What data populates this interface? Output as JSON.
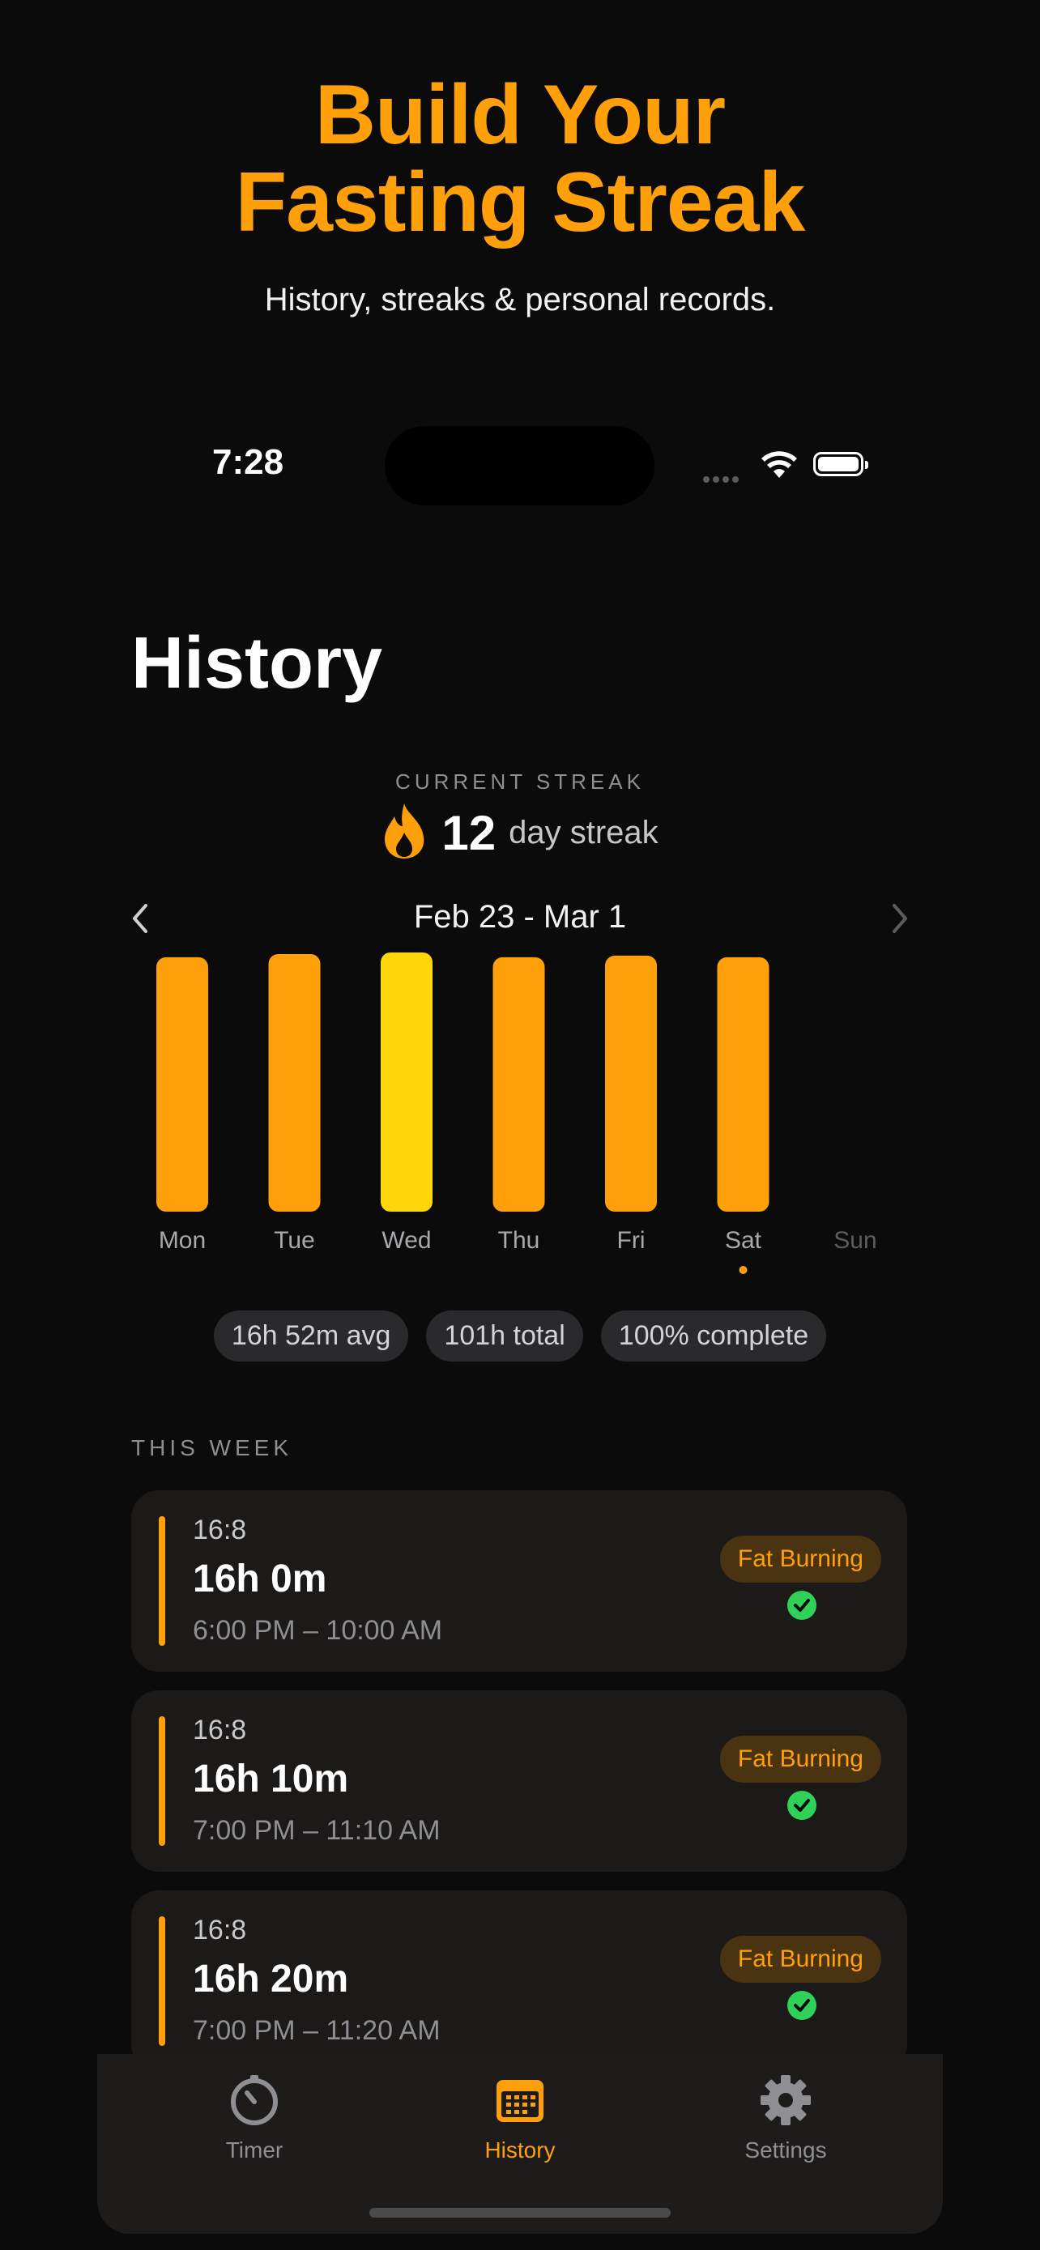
{
  "promo": {
    "title_line1": "Build Your",
    "title_line2": "Fasting Streak",
    "subtitle": "History, streaks & personal records."
  },
  "status_bar": {
    "time": "7:28"
  },
  "page": {
    "title": "History"
  },
  "streak": {
    "label": "CURRENT STREAK",
    "count": "12",
    "suffix": "day streak"
  },
  "week": {
    "range": "Feb 23 - Mar 1"
  },
  "chart_data": {
    "type": "bar",
    "categories": [
      "Mon",
      "Tue",
      "Wed",
      "Thu",
      "Fri",
      "Sat",
      "Sun"
    ],
    "values": [
      16,
      16.2,
      16.3,
      16,
      16.1,
      16,
      0
    ],
    "highlight": "Wed",
    "today": "Sat",
    "colors": {
      "bar": "#ff9f0a",
      "highlight": "#ffd60a",
      "label": "#a8a8ad",
      "future_label": "#5c5c60"
    }
  },
  "stats": {
    "avg": "16h 52m avg",
    "total": "101h total",
    "complete": "100% complete"
  },
  "section_title": "THIS WEEK",
  "fasts": [
    {
      "plan": "16:8",
      "duration": "16h 0m",
      "range": "6:00 PM – 10:00 AM",
      "badge": "Fat Burning"
    },
    {
      "plan": "16:8",
      "duration": "16h 10m",
      "range": "7:00 PM – 11:10 AM",
      "badge": "Fat Burning"
    },
    {
      "plan": "16:8",
      "duration": "16h 20m",
      "range": "7:00 PM – 11:20 AM",
      "badge": "Fat Burning"
    }
  ],
  "tabs": [
    {
      "label": "Timer",
      "icon": "timer-icon",
      "active": false
    },
    {
      "label": "History",
      "icon": "calendar-icon",
      "active": true
    },
    {
      "label": "Settings",
      "icon": "gear-icon",
      "active": false
    }
  ],
  "colors": {
    "accent": "#ff9f0a",
    "success": "#30d158",
    "background": "#0b0b0b"
  }
}
